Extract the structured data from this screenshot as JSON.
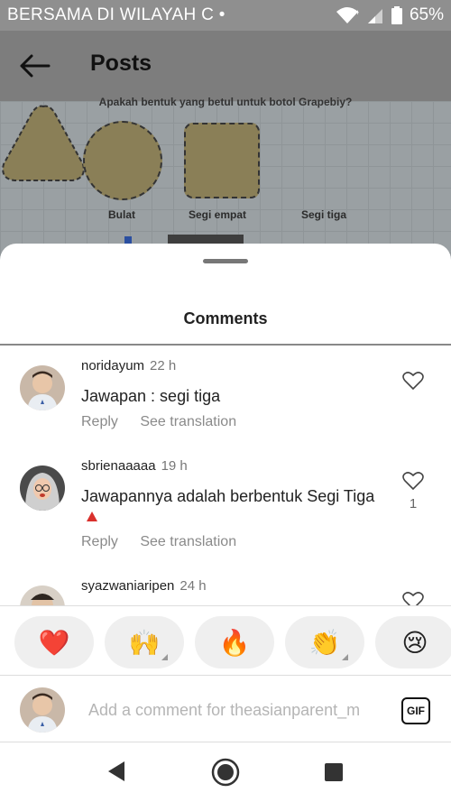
{
  "status_bar": {
    "notification_text": "BERSAMA DI WILAYAH C •",
    "battery": "65%"
  },
  "header": {
    "title": "Posts"
  },
  "post": {
    "question": "Apakah bentuk yang betul untuk botol Grapebiy?",
    "shape_labels": [
      "Bulat",
      "Segi empat",
      "Segi tiga"
    ]
  },
  "sheet": {
    "title": "Comments"
  },
  "comments": [
    {
      "username": "noridayum",
      "time": "22 h",
      "text": "Jawapan : segi tiga",
      "reply": "Reply",
      "translate": "See translation",
      "likes": ""
    },
    {
      "username": "sbrienaaaaa",
      "time": "19 h",
      "text": "Jawapannya adalah berbentuk Segi Tiga",
      "reply": "Reply",
      "translate": "See translation",
      "likes": "1"
    },
    {
      "username": "syazwaniaripen",
      "time": "24 h",
      "text": "",
      "reply": "",
      "translate": "",
      "likes": ""
    }
  ],
  "reactions": [
    {
      "emoji": "❤️",
      "name": "heart"
    },
    {
      "emoji": "🙌",
      "name": "raising-hands"
    },
    {
      "emoji": "🔥",
      "name": "fire"
    },
    {
      "emoji": "👏",
      "name": "clapping-hands"
    },
    {
      "emoji": "😢",
      "name": "crying-face"
    }
  ],
  "composer": {
    "placeholder": "Add a comment for theasianparent_m",
    "gif_label": "GIF"
  },
  "colors": {
    "status_bar_bg": "#8f8f8f",
    "overlay_bg": "#7d7d7d",
    "accent_red": "#d9302c"
  }
}
